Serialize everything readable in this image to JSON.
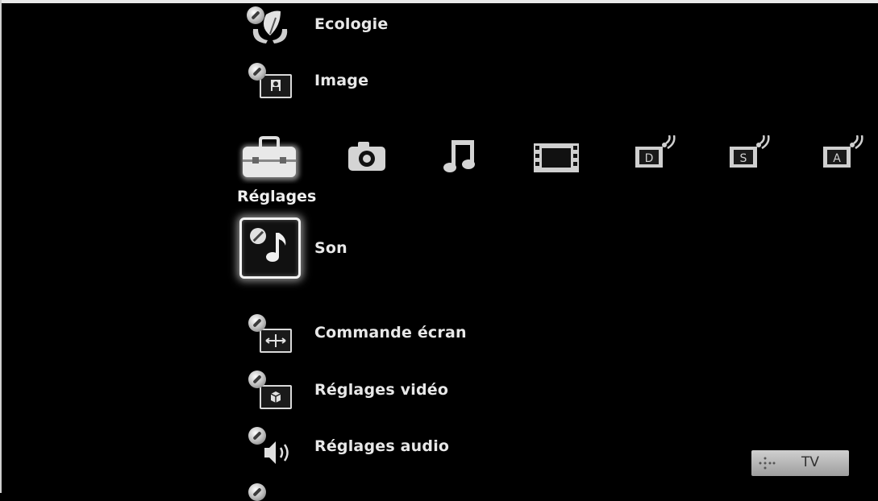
{
  "menu": {
    "items": [
      {
        "label": "Ecologie",
        "icon": "ecology-hands-leaf-icon"
      },
      {
        "label": "Image",
        "icon": "image-settings-icon"
      },
      {
        "label": "Son",
        "icon": "sound-note-icon",
        "selected": true
      },
      {
        "label": "Commande écran",
        "icon": "screen-control-icon"
      },
      {
        "label": "Réglages vidéo",
        "icon": "video-settings-icon"
      },
      {
        "label": "Réglages audio",
        "icon": "audio-settings-icon"
      }
    ]
  },
  "categories": {
    "selected_label": "Réglages",
    "items": [
      {
        "icon": "toolbox-icon",
        "selected": true
      },
      {
        "icon": "camera-icon"
      },
      {
        "icon": "music-icon"
      },
      {
        "icon": "film-icon"
      },
      {
        "icon": "digital-broadcast-icon",
        "letter": "D"
      },
      {
        "icon": "satellite-broadcast-icon",
        "letter": "S"
      },
      {
        "icon": "analog-broadcast-icon",
        "letter": "A"
      }
    ]
  },
  "badge": {
    "text": "TV",
    "icon": "input-dots-icon"
  },
  "colors": {
    "background": "#000000",
    "text": "#e8e8e8",
    "highlight": "#ffffff"
  }
}
